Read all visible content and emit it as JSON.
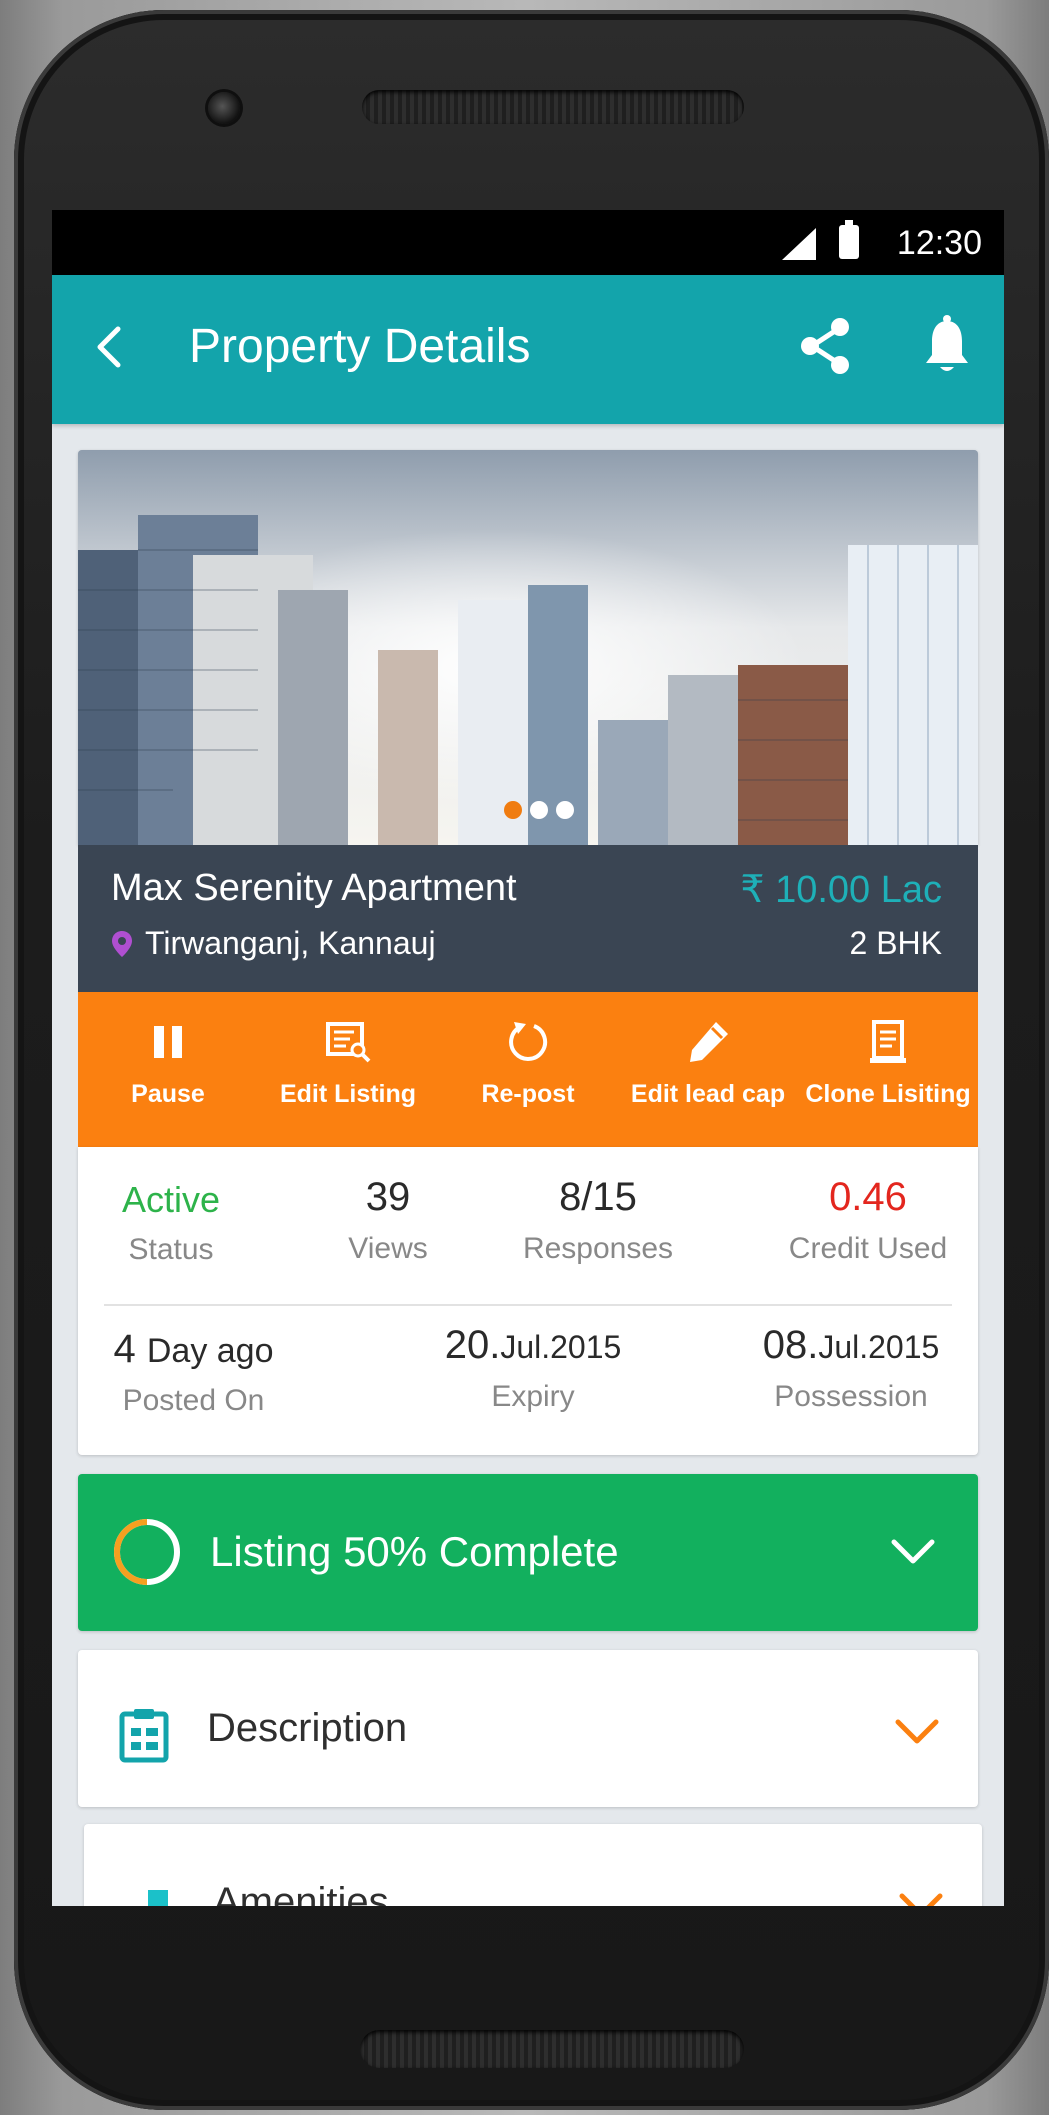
{
  "status_bar": {
    "time": "12:30"
  },
  "header": {
    "title": "Property Details",
    "back_icon": "back-arrow-icon",
    "share_icon": "share-icon",
    "bell_icon": "bell-icon"
  },
  "listing": {
    "name": "Max Serenity Apartment",
    "price": "₹ 10.00 Lac",
    "location": "Tirwanganj, Kannauj",
    "bhk": "2 BHK",
    "carousel": {
      "total": 3,
      "active": 0
    }
  },
  "actions": [
    {
      "label": "Pause",
      "icon": "pause-icon"
    },
    {
      "label": "Edit Listing",
      "icon": "edit-listing-icon"
    },
    {
      "label": "Re-post",
      "icon": "repost-icon"
    },
    {
      "label": "Edit lead cap",
      "icon": "pencil-icon"
    },
    {
      "label": "Clone Lisiting",
      "icon": "clone-icon"
    }
  ],
  "stats": {
    "status": {
      "value": "Active",
      "label": "Status"
    },
    "views": {
      "value": "39",
      "label": "Views"
    },
    "responses": {
      "value": "8/15",
      "label": "Responses"
    },
    "credit": {
      "value": "0.46",
      "label": "Credit Used"
    },
    "posted": {
      "value_num": "4",
      "value_unit": "Day ago",
      "label": "Posted On"
    },
    "expiry": {
      "value_day": "20.",
      "value_rest": "Jul.2015",
      "label": "Expiry"
    },
    "possession": {
      "value_day": "08.",
      "value_rest": "Jul.2015",
      "label": "Possession"
    }
  },
  "progress": {
    "text": "Listing 50% Complete",
    "fraction": 0.5
  },
  "sections": [
    {
      "title": "Description",
      "icon": "clipboard-icon"
    },
    {
      "title": "Amenities",
      "icon": "building-icon"
    }
  ],
  "colors": {
    "teal": "#13a4ab",
    "orange": "#fb8010",
    "green": "#12b05e",
    "active_green": "#2db34a",
    "credit_red": "#e3261e",
    "info_bar": "#3a4553"
  }
}
